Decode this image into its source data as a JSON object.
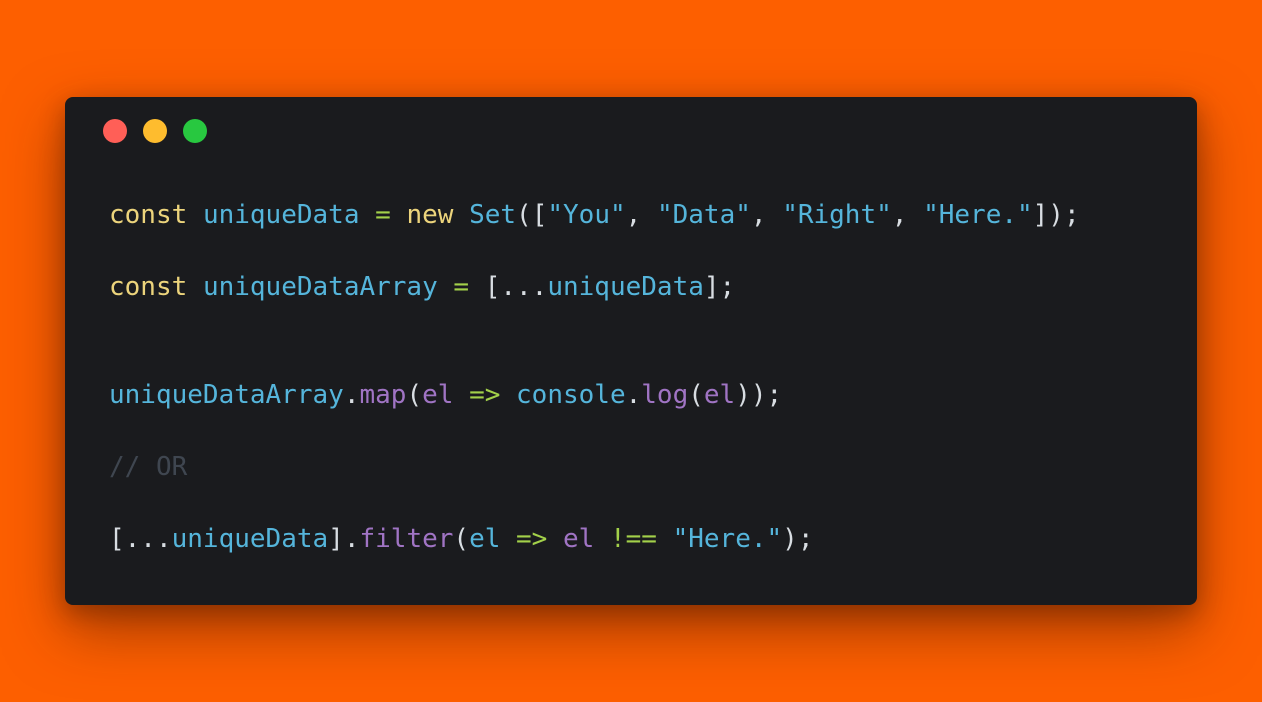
{
  "window": {
    "traffic_lights": [
      {
        "name": "close",
        "color": "#ff5f57"
      },
      {
        "name": "minimize",
        "color": "#febc2e"
      },
      {
        "name": "maximize",
        "color": "#28c840"
      }
    ]
  },
  "palette": {
    "background": "#fd5f00",
    "window": "#1a1b1e",
    "keyword": "#ecd47c",
    "identifier": "#55b5db",
    "string": "#55b5db",
    "function": "#a074c4",
    "operator": "#a3d14a",
    "punctuation": "#d8dde2",
    "comment": "#3f4650"
  },
  "code": {
    "lines": [
      [
        {
          "t": "const",
          "c": "keyword"
        },
        {
          "t": " ",
          "c": "punctuation"
        },
        {
          "t": "uniqueData",
          "c": "identifier"
        },
        {
          "t": " ",
          "c": "punctuation"
        },
        {
          "t": "=",
          "c": "operator"
        },
        {
          "t": " ",
          "c": "punctuation"
        },
        {
          "t": "new",
          "c": "keyword"
        },
        {
          "t": " ",
          "c": "punctuation"
        },
        {
          "t": "Set",
          "c": "identifier"
        },
        {
          "t": "([",
          "c": "punctuation"
        },
        {
          "t": "\"You\"",
          "c": "string"
        },
        {
          "t": ", ",
          "c": "punctuation"
        },
        {
          "t": "\"Data\"",
          "c": "string"
        },
        {
          "t": ", ",
          "c": "punctuation"
        },
        {
          "t": "\"Right\"",
          "c": "string"
        },
        {
          "t": ", ",
          "c": "punctuation"
        },
        {
          "t": "\"Here.\"",
          "c": "string"
        },
        {
          "t": "]);",
          "c": "punctuation"
        }
      ],
      [
        {
          "t": "const",
          "c": "keyword"
        },
        {
          "t": " ",
          "c": "punctuation"
        },
        {
          "t": "uniqueDataArray",
          "c": "identifier"
        },
        {
          "t": " ",
          "c": "punctuation"
        },
        {
          "t": "=",
          "c": "operator"
        },
        {
          "t": " [...",
          "c": "punctuation"
        },
        {
          "t": "uniqueData",
          "c": "identifier"
        },
        {
          "t": "];",
          "c": "punctuation"
        }
      ],
      [
        {
          "t": "uniqueDataArray",
          "c": "identifier"
        },
        {
          "t": ".",
          "c": "punctuation"
        },
        {
          "t": "map",
          "c": "function"
        },
        {
          "t": "(",
          "c": "punctuation"
        },
        {
          "t": "el",
          "c": "function"
        },
        {
          "t": " ",
          "c": "punctuation"
        },
        {
          "t": "=>",
          "c": "operator"
        },
        {
          "t": " ",
          "c": "punctuation"
        },
        {
          "t": "console",
          "c": "identifier"
        },
        {
          "t": ".",
          "c": "punctuation"
        },
        {
          "t": "log",
          "c": "function"
        },
        {
          "t": "(",
          "c": "punctuation"
        },
        {
          "t": "el",
          "c": "function"
        },
        {
          "t": "));",
          "c": "punctuation"
        }
      ],
      [
        {
          "t": "// OR",
          "c": "comment"
        }
      ],
      [
        {
          "t": "[...",
          "c": "punctuation"
        },
        {
          "t": "uniqueData",
          "c": "identifier"
        },
        {
          "t": "].",
          "c": "punctuation"
        },
        {
          "t": "filter",
          "c": "function"
        },
        {
          "t": "(",
          "c": "punctuation"
        },
        {
          "t": "el",
          "c": "identifier"
        },
        {
          "t": " ",
          "c": "punctuation"
        },
        {
          "t": "=>",
          "c": "operator"
        },
        {
          "t": " ",
          "c": "punctuation"
        },
        {
          "t": "el",
          "c": "function"
        },
        {
          "t": " ",
          "c": "punctuation"
        },
        {
          "t": "!==",
          "c": "operator"
        },
        {
          "t": " ",
          "c": "punctuation"
        },
        {
          "t": "\"Here.\"",
          "c": "string"
        },
        {
          "t": ");",
          "c": "punctuation"
        }
      ]
    ]
  }
}
